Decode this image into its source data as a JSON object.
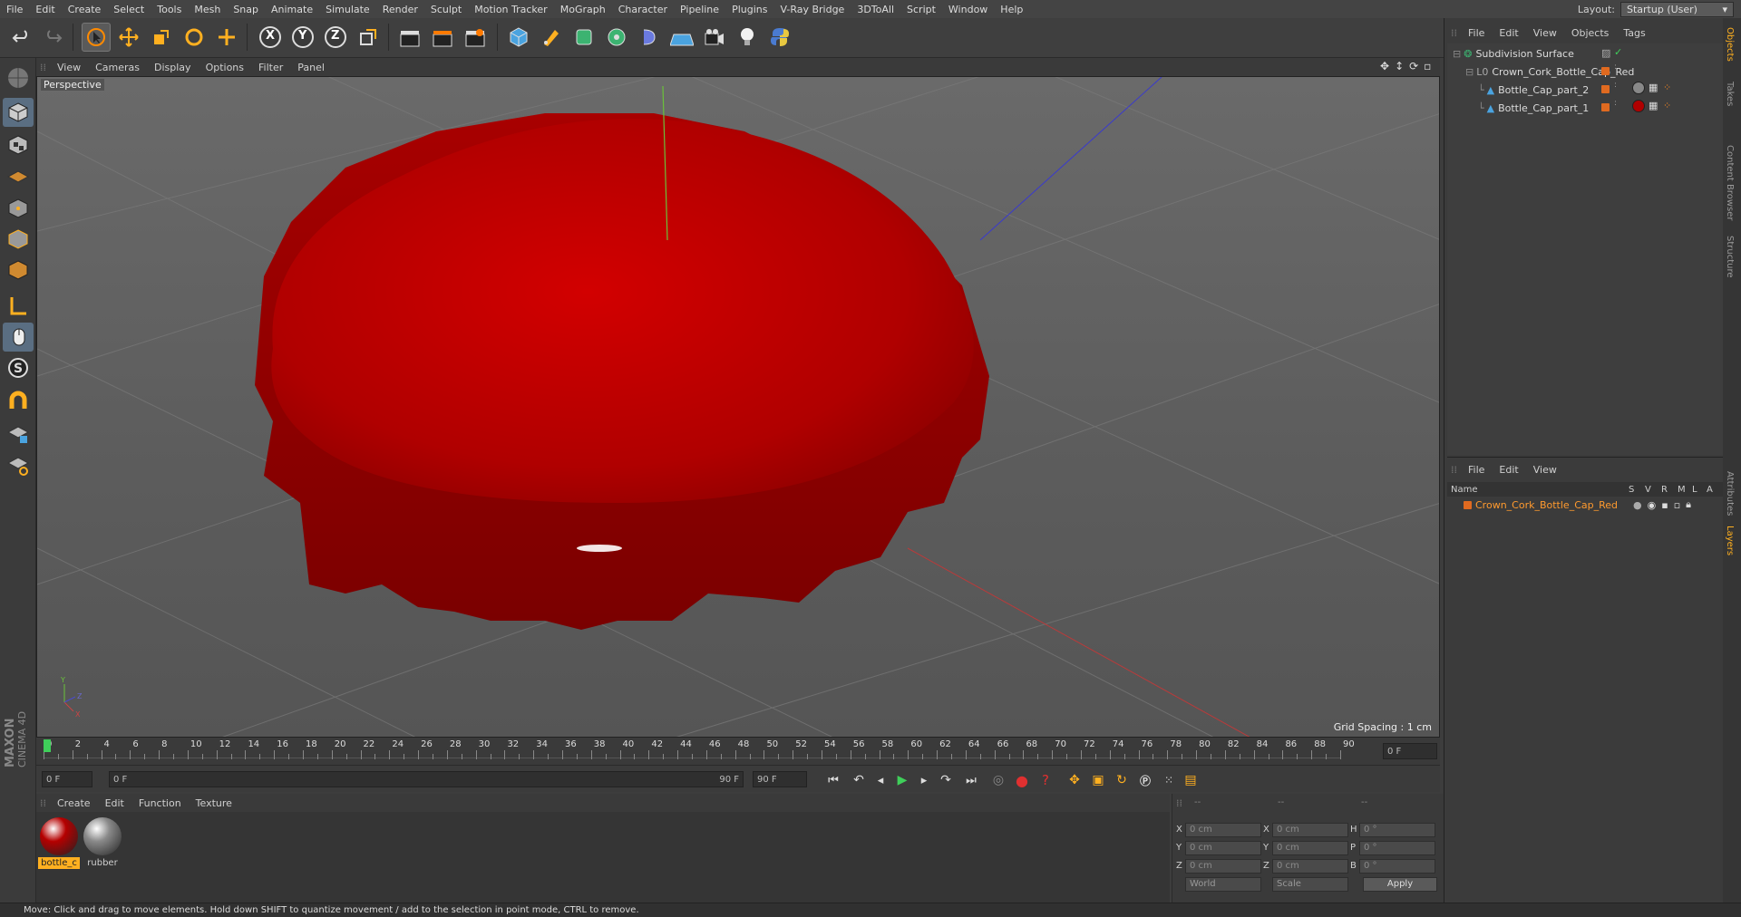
{
  "menubar": [
    "File",
    "Edit",
    "Create",
    "Select",
    "Tools",
    "Mesh",
    "Snap",
    "Animate",
    "Simulate",
    "Render",
    "Sculpt",
    "Motion Tracker",
    "MoGraph",
    "Character",
    "Pipeline",
    "Plugins",
    "V-Ray Bridge",
    "3DToAll",
    "Script",
    "Window",
    "Help"
  ],
  "layout": {
    "label": "Layout:",
    "value": "Startup (User)"
  },
  "toolbar": {
    "undo": "undo-icon",
    "redo": "redo-icon",
    "axis_x": "X",
    "axis_y": "Y",
    "axis_z": "Z"
  },
  "viewport": {
    "menu": [
      "View",
      "Cameras",
      "Display",
      "Options",
      "Filter",
      "Panel"
    ],
    "label": "Perspective",
    "grid_spacing": "Grid Spacing : 1 cm",
    "cap_color": "#c10000"
  },
  "timeline": {
    "ticks": [
      "0",
      "2",
      "4",
      "6",
      "8",
      "10",
      "12",
      "14",
      "16",
      "18",
      "20",
      "22",
      "24",
      "26",
      "28",
      "30",
      "32",
      "34",
      "36",
      "38",
      "40",
      "42",
      "44",
      "46",
      "48",
      "50",
      "52",
      "54",
      "56",
      "58",
      "60",
      "62",
      "64",
      "66",
      "68",
      "70",
      "72",
      "74",
      "76",
      "78",
      "80",
      "82",
      "84",
      "86",
      "88",
      "90"
    ],
    "current_frame": "0 F",
    "start_field": "0 F",
    "range_start": "0 F",
    "range_end": "90 F",
    "end_field": "90 F"
  },
  "materials": {
    "menu": [
      "Create",
      "Edit",
      "Function",
      "Texture"
    ],
    "items": [
      {
        "name": "bottle_c",
        "color": "#b50000",
        "selected": true
      },
      {
        "name": "rubber",
        "color": "#8a8a8a",
        "selected": false
      }
    ]
  },
  "coords": {
    "rows": [
      {
        "a": "X",
        "av": "0 cm",
        "b": "X",
        "bv": "0 cm",
        "c": "H",
        "cv": "0 °"
      },
      {
        "a": "Y",
        "av": "0 cm",
        "b": "Y",
        "bv": "0 cm",
        "c": "P",
        "cv": "0 °"
      },
      {
        "a": "Z",
        "av": "0 cm",
        "b": "Z",
        "bv": "0 cm",
        "c": "B",
        "cv": "0 °"
      }
    ],
    "headers": [
      "--",
      "--",
      "--"
    ],
    "world": "World",
    "scale": "Scale",
    "apply": "Apply"
  },
  "objects": {
    "menu": [
      "File",
      "Edit",
      "View",
      "Objects",
      "Tags"
    ],
    "items": [
      {
        "name": "Subdivision Surface",
        "indent": 0
      },
      {
        "name": "Crown_Cork_Bottle_Cap_Red",
        "indent": 1
      },
      {
        "name": "Bottle_Cap_part_2",
        "indent": 2
      },
      {
        "name": "Bottle_Cap_part_1",
        "indent": 2
      }
    ]
  },
  "layers": {
    "menu": [
      "File",
      "Edit",
      "View"
    ],
    "headers": {
      "name": "Name",
      "s": "S",
      "v": "V",
      "r": "R",
      "m": "M",
      "l": "L",
      "a": "A"
    },
    "row": "Crown_Cork_Bottle_Cap_Red"
  },
  "sidetabs": [
    "Objects",
    "Takes",
    "Content Browser",
    "Structure",
    "Attributes",
    "Layers"
  ],
  "status": "Move: Click and drag to move elements. Hold down SHIFT to quantize movement / add to the selection in point mode, CTRL to remove.",
  "brand": {
    "line1": "MAXON",
    "line2": "CINEMA 4D"
  }
}
